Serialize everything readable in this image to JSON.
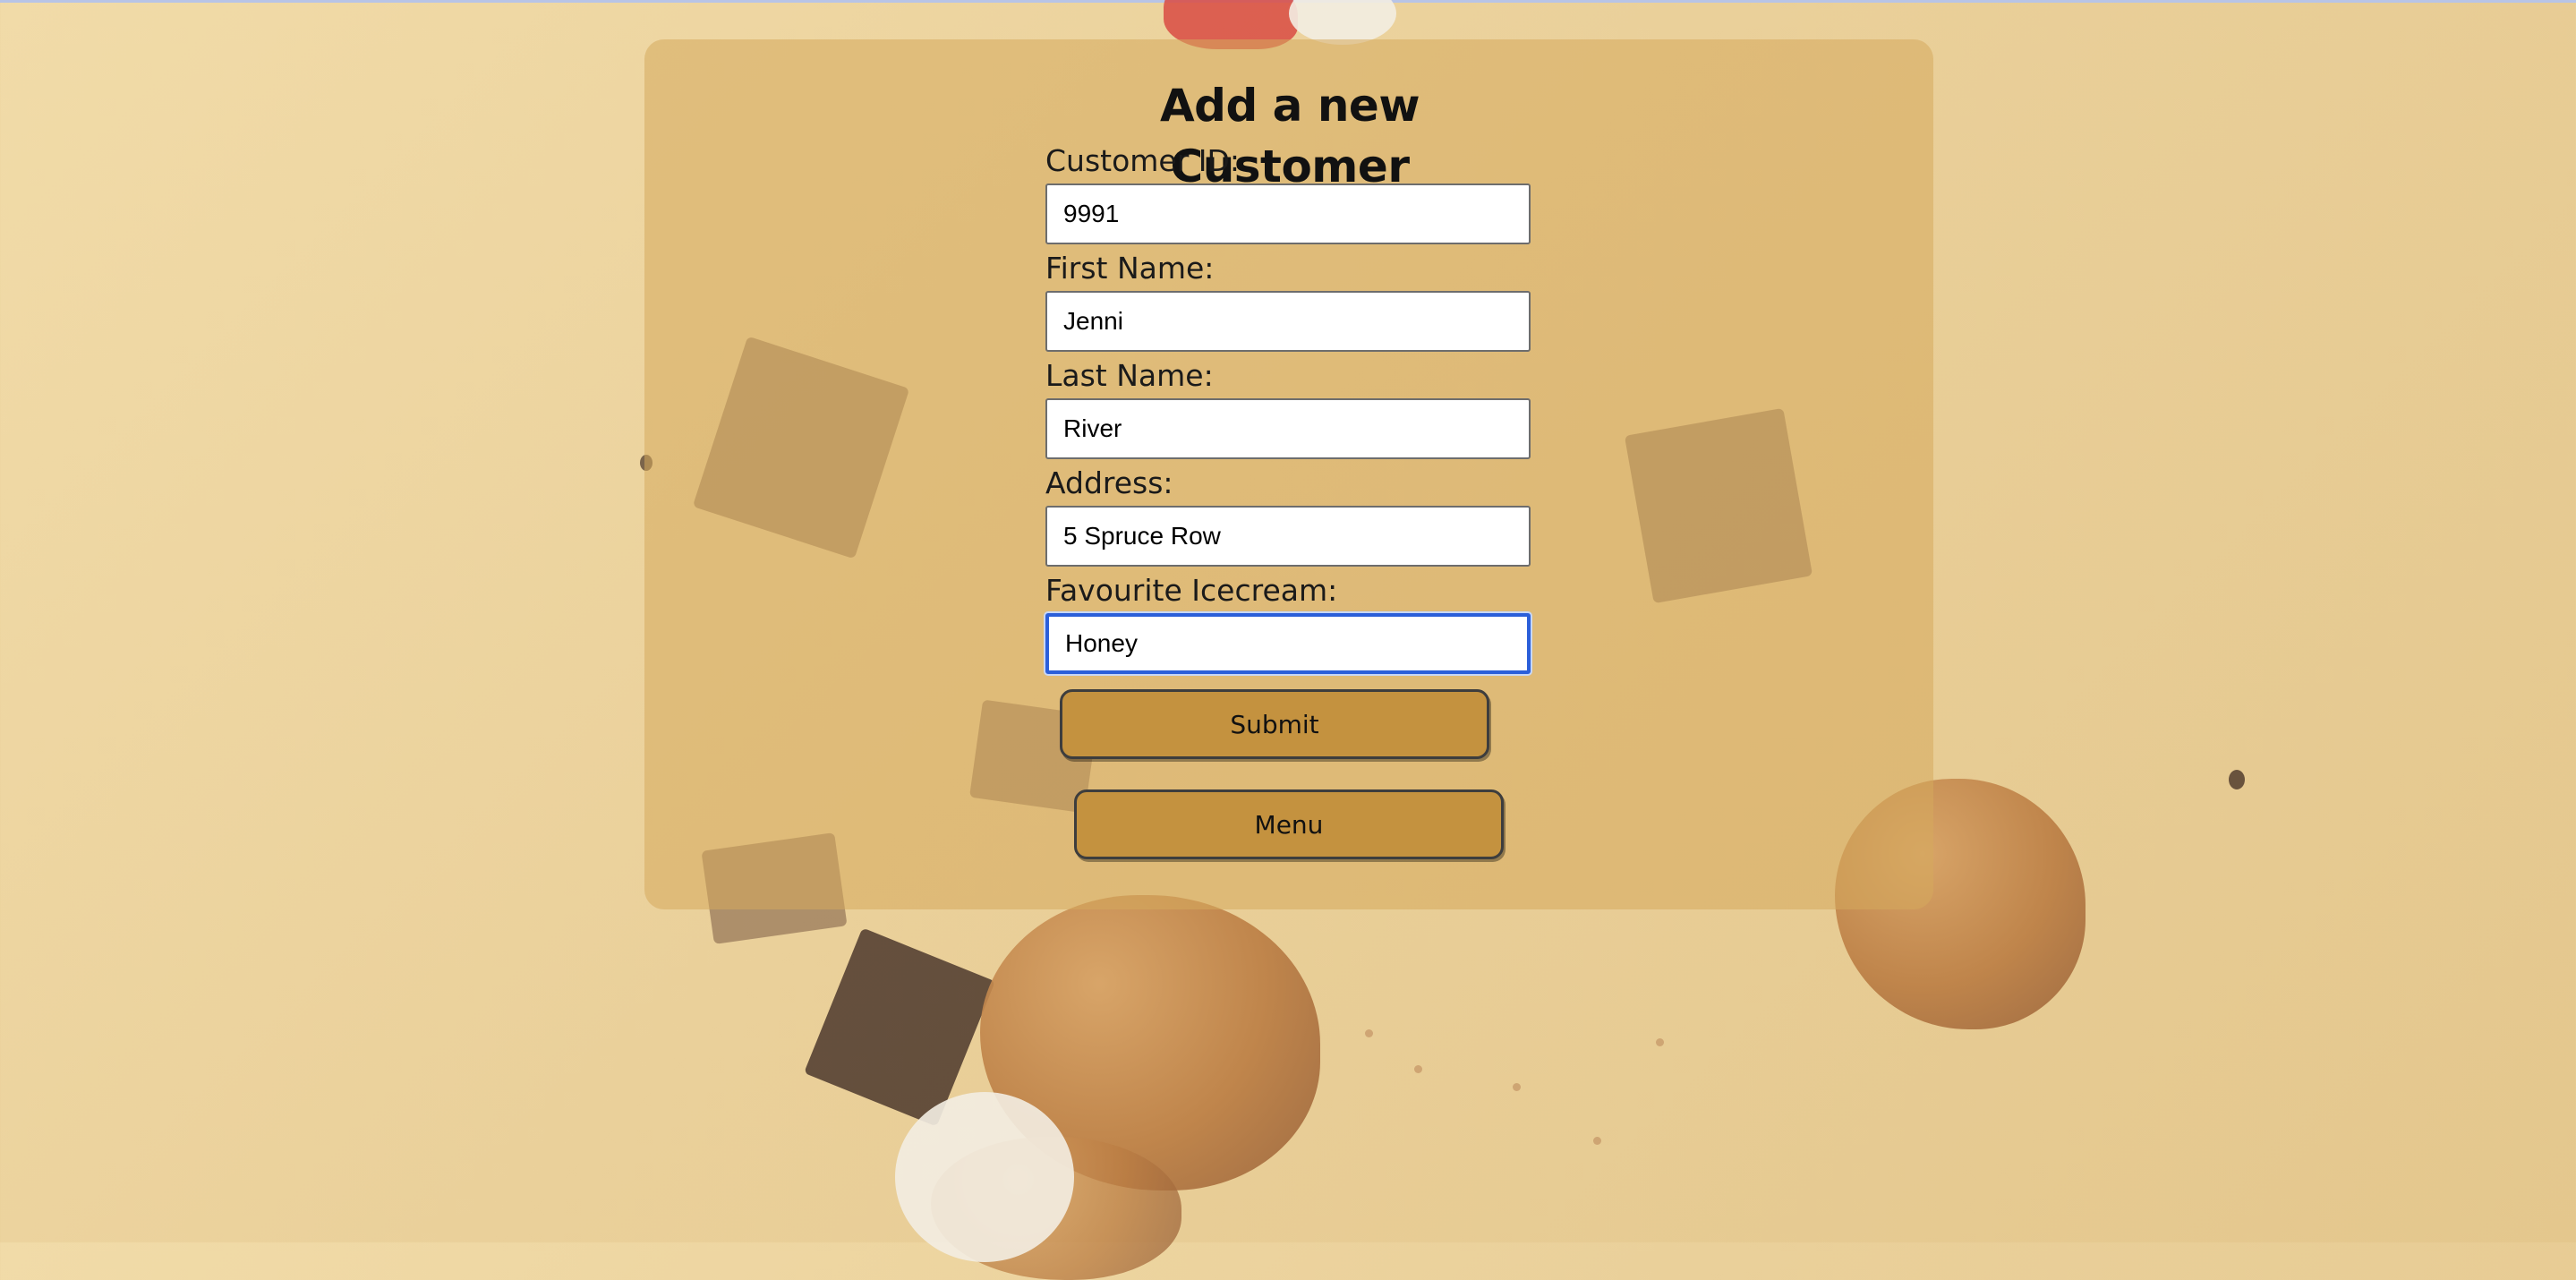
{
  "page": {
    "title": "Add a new Customer"
  },
  "form": {
    "fields": [
      {
        "label": "Customer ID:",
        "value": "9991"
      },
      {
        "label": "First Name:",
        "value": "Jenni"
      },
      {
        "label": "Last Name:",
        "value": "River"
      },
      {
        "label": "Address:",
        "value": "5 Spruce Row"
      },
      {
        "label": "Favourite Icecream:",
        "value": "Honey"
      }
    ],
    "focused_field": "Favourite Icecream:"
  },
  "buttons": {
    "submit_label": "Submit",
    "menu_label": "Menu"
  },
  "colors": {
    "button_fill": "#c4923f",
    "panel_tint": "#d6aa5c",
    "focus_ring": "#2b5fd9"
  }
}
